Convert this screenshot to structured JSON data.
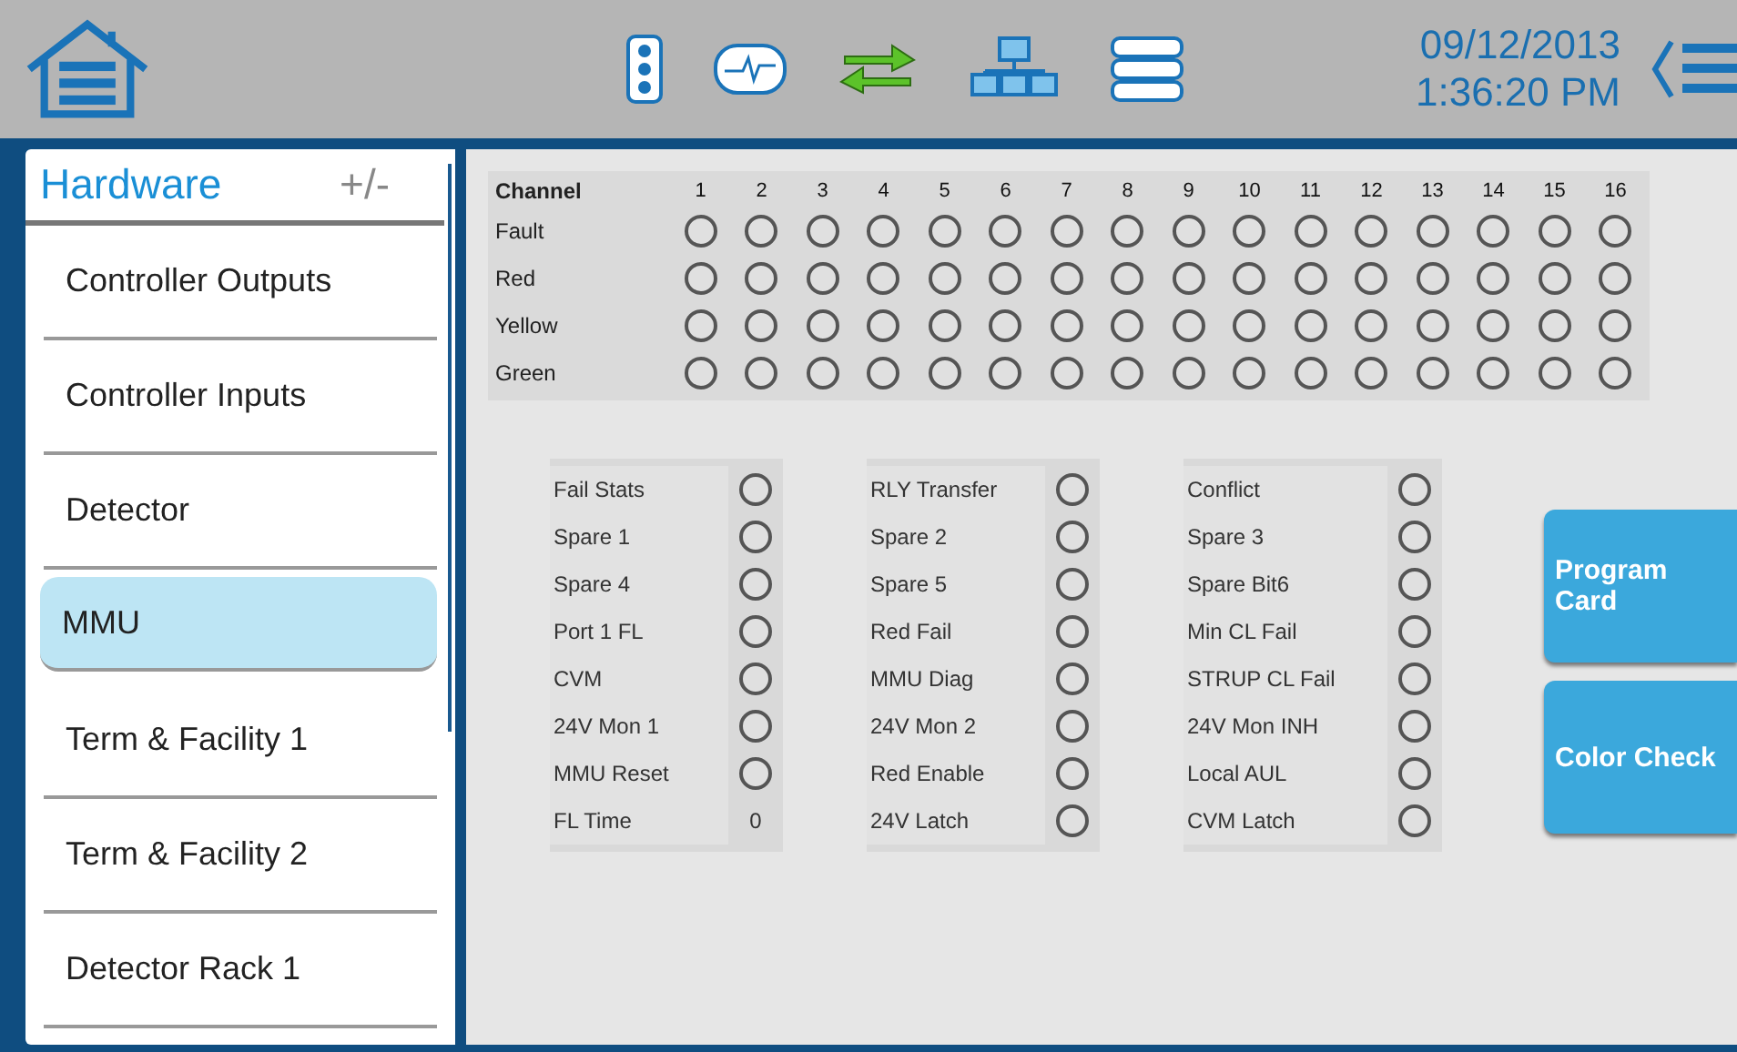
{
  "header": {
    "date": "09/12/2013",
    "time": "1:36:20 PM"
  },
  "sidebar": {
    "title": "Hardware",
    "toggle": "+/-",
    "items": [
      {
        "label": "Controller Outputs",
        "selected": false
      },
      {
        "label": "Controller Inputs",
        "selected": false
      },
      {
        "label": "Detector",
        "selected": false
      },
      {
        "label": "MMU",
        "selected": true
      },
      {
        "label": "Term & Facility 1",
        "selected": false
      },
      {
        "label": "Term & Facility 2",
        "selected": false
      },
      {
        "label": "Detector Rack 1",
        "selected": false
      }
    ]
  },
  "channel_grid": {
    "heading": "Channel",
    "channels": [
      "1",
      "2",
      "3",
      "4",
      "5",
      "6",
      "7",
      "8",
      "9",
      "10",
      "11",
      "12",
      "13",
      "14",
      "15",
      "16"
    ],
    "rows": [
      {
        "label": "Fault"
      },
      {
        "label": "Red"
      },
      {
        "label": "Yellow"
      },
      {
        "label": "Green"
      }
    ]
  },
  "status_groups": [
    {
      "items": [
        {
          "label": "Fail Stats",
          "kind": "led"
        },
        {
          "label": "Spare 1",
          "kind": "led"
        },
        {
          "label": "Spare 4",
          "kind": "led"
        },
        {
          "label": "Port 1 FL",
          "kind": "led"
        },
        {
          "label": "CVM",
          "kind": "led"
        },
        {
          "label": "24V Mon 1",
          "kind": "led"
        },
        {
          "label": "MMU Reset",
          "kind": "led"
        },
        {
          "label": "FL Time",
          "kind": "value",
          "value": "0"
        }
      ]
    },
    {
      "items": [
        {
          "label": "RLY Transfer",
          "kind": "led"
        },
        {
          "label": "Spare 2",
          "kind": "led"
        },
        {
          "label": "Spare 5",
          "kind": "led"
        },
        {
          "label": "Red Fail",
          "kind": "led"
        },
        {
          "label": "MMU Diag",
          "kind": "led"
        },
        {
          "label": "24V Mon 2",
          "kind": "led"
        },
        {
          "label": "Red Enable",
          "kind": "led"
        },
        {
          "label": "24V Latch",
          "kind": "led"
        }
      ]
    },
    {
      "items": [
        {
          "label": "Conflict",
          "kind": "led"
        },
        {
          "label": "Spare 3",
          "kind": "led"
        },
        {
          "label": "Spare Bit6",
          "kind": "led"
        },
        {
          "label": "Min CL Fail",
          "kind": "led"
        },
        {
          "label": "STRUP CL Fail",
          "kind": "led"
        },
        {
          "label": "24V Mon INH",
          "kind": "led"
        },
        {
          "label": "Local AUL",
          "kind": "led"
        },
        {
          "label": "CVM Latch",
          "kind": "led"
        }
      ]
    }
  ],
  "buttons": [
    {
      "label": "Program Card"
    },
    {
      "label": "Color Check"
    }
  ]
}
